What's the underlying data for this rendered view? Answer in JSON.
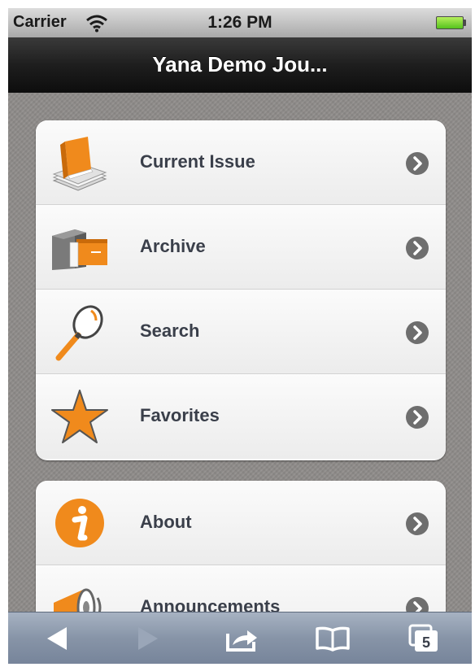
{
  "status_bar": {
    "carrier": "Carrier",
    "time": "1:26 PM",
    "wifi_icon": "wifi-icon",
    "battery_icon": "battery-icon"
  },
  "nav_bar": {
    "title": "Yana Demo Jou..."
  },
  "menu_groups": [
    {
      "items": [
        {
          "label": "Current Issue",
          "icon": "book-stack-icon"
        },
        {
          "label": "Archive",
          "icon": "archive-box-icon"
        },
        {
          "label": "Search",
          "icon": "magnifier-icon"
        },
        {
          "label": "Favorites",
          "icon": "star-icon"
        }
      ]
    },
    {
      "items": [
        {
          "label": "About",
          "icon": "info-icon"
        },
        {
          "label": "Announcements",
          "icon": "megaphone-icon"
        }
      ]
    }
  ],
  "toolbar": {
    "back_icon": "back-arrow-icon",
    "forward_icon": "forward-arrow-icon",
    "share_icon": "share-icon",
    "bookmarks_icon": "bookmarks-icon",
    "tabs_icon": "tabs-icon",
    "tabs_count": "5"
  },
  "colors": {
    "accent_orange": "#f08a1c",
    "chevron_gray": "#6e6e6e",
    "label_text": "#3a3f4a",
    "nav_bar": "#1e1e1e",
    "toolbar": "#8794a7"
  }
}
